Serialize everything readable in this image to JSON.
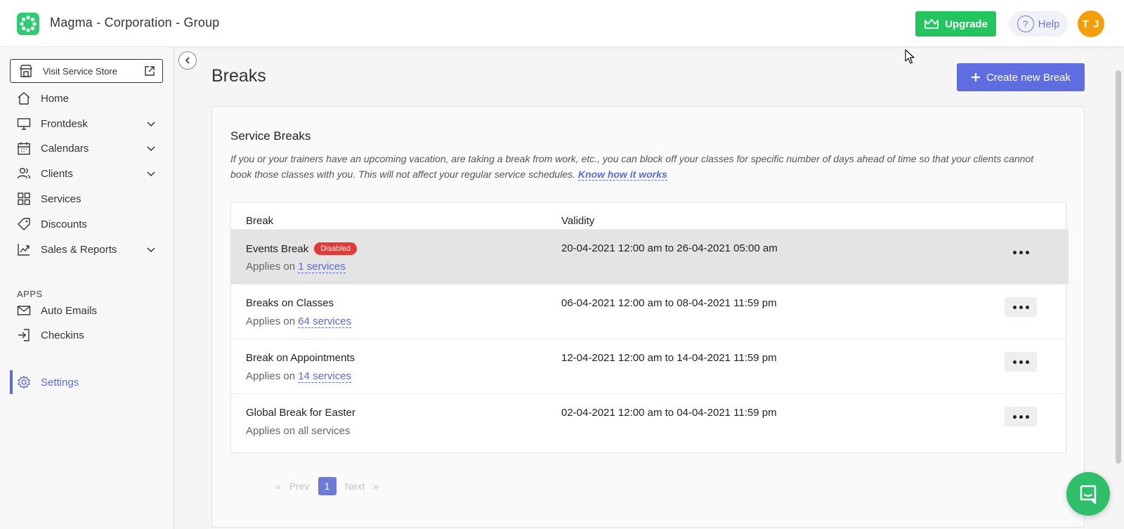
{
  "header": {
    "app_title": "Magma - Corporation - Group",
    "upgrade_label": "Upgrade",
    "help_label": "Help",
    "help_glyph": "?",
    "avatar_initials": "T J",
    "brand_color": "#22c55e",
    "accent_color": "#5e6ee0",
    "avatar_color": "#f59e0b"
  },
  "sidebar": {
    "store_label": "Visit Service Store",
    "items": [
      {
        "label": "Home",
        "icon": "home-icon",
        "has_chevron": false
      },
      {
        "label": "Frontdesk",
        "icon": "monitor-icon",
        "has_chevron": true
      },
      {
        "label": "Calendars",
        "icon": "calendar-icon",
        "has_chevron": true
      },
      {
        "label": "Clients",
        "icon": "users-icon",
        "has_chevron": true
      },
      {
        "label": "Services",
        "icon": "grid-icon",
        "has_chevron": false
      },
      {
        "label": "Discounts",
        "icon": "tag-icon",
        "has_chevron": false
      },
      {
        "label": "Sales & Reports",
        "icon": "chart-icon",
        "has_chevron": true
      }
    ],
    "apps_heading": "APPS",
    "apps": [
      {
        "label": "Auto Emails",
        "icon": "mail-icon"
      },
      {
        "label": "Checkins",
        "icon": "checkin-icon"
      }
    ],
    "settings_label": "Settings"
  },
  "main": {
    "page_title": "Breaks",
    "create_label": "Create new Break",
    "card": {
      "title": "Service Breaks",
      "description": "If you or your trainers have an upcoming vacation, are taking a break from work, etc., you can block off your classes for specific number of days ahead of time so that your clients cannot book those classes with you. This will not affect your regular service schedules.",
      "know_link": "Know how it works"
    },
    "table": {
      "headers": {
        "break": "Break",
        "validity": "Validity"
      },
      "rows": [
        {
          "name": "Events Break",
          "badge": "Disabled",
          "applies_prefix": "Applies on",
          "applies_link": "1 services",
          "validity": "20-04-2021 12:00 am to 26-04-2021 05:00 am"
        },
        {
          "name": "Breaks on Classes",
          "badge": "",
          "applies_prefix": "Applies on",
          "applies_link": "64 services",
          "validity": "06-04-2021 12:00 am to 08-04-2021 11:59 pm"
        },
        {
          "name": "Break on Appointments",
          "badge": "",
          "applies_prefix": "Applies on",
          "applies_link": "14 services",
          "validity": "12-04-2021 12:00 am to 14-04-2021 11:59 pm"
        },
        {
          "name": "Global Break for Easter",
          "badge": "",
          "applies_prefix": "Applies on all services",
          "applies_link": "",
          "validity": "02-04-2021 12:00 am to 04-04-2021 11:59 pm"
        }
      ]
    },
    "pagination": {
      "first": "«",
      "prev": "Prev",
      "current": "1",
      "next": "Next",
      "last": "»"
    }
  }
}
